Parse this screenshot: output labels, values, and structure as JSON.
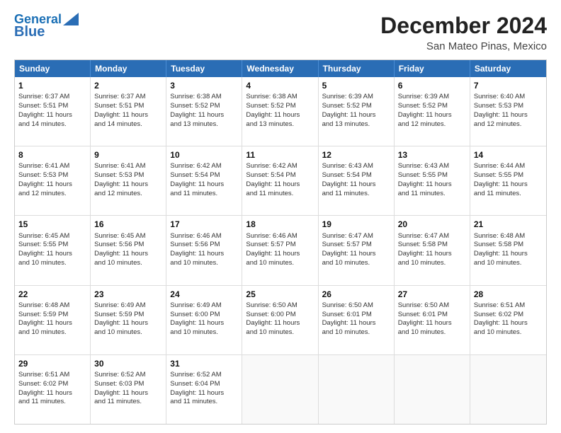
{
  "header": {
    "logo_line1": "General",
    "logo_line2": "Blue",
    "title": "December 2024",
    "location": "San Mateo Pinas, Mexico"
  },
  "weekdays": [
    "Sunday",
    "Monday",
    "Tuesday",
    "Wednesday",
    "Thursday",
    "Friday",
    "Saturday"
  ],
  "weeks": [
    [
      {
        "day": "1",
        "lines": [
          "Sunrise: 6:37 AM",
          "Sunset: 5:51 PM",
          "Daylight: 11 hours",
          "and 14 minutes."
        ]
      },
      {
        "day": "2",
        "lines": [
          "Sunrise: 6:37 AM",
          "Sunset: 5:51 PM",
          "Daylight: 11 hours",
          "and 14 minutes."
        ]
      },
      {
        "day": "3",
        "lines": [
          "Sunrise: 6:38 AM",
          "Sunset: 5:52 PM",
          "Daylight: 11 hours",
          "and 13 minutes."
        ]
      },
      {
        "day": "4",
        "lines": [
          "Sunrise: 6:38 AM",
          "Sunset: 5:52 PM",
          "Daylight: 11 hours",
          "and 13 minutes."
        ]
      },
      {
        "day": "5",
        "lines": [
          "Sunrise: 6:39 AM",
          "Sunset: 5:52 PM",
          "Daylight: 11 hours",
          "and 13 minutes."
        ]
      },
      {
        "day": "6",
        "lines": [
          "Sunrise: 6:39 AM",
          "Sunset: 5:52 PM",
          "Daylight: 11 hours",
          "and 12 minutes."
        ]
      },
      {
        "day": "7",
        "lines": [
          "Sunrise: 6:40 AM",
          "Sunset: 5:53 PM",
          "Daylight: 11 hours",
          "and 12 minutes."
        ]
      }
    ],
    [
      {
        "day": "8",
        "lines": [
          "Sunrise: 6:41 AM",
          "Sunset: 5:53 PM",
          "Daylight: 11 hours",
          "and 12 minutes."
        ]
      },
      {
        "day": "9",
        "lines": [
          "Sunrise: 6:41 AM",
          "Sunset: 5:53 PM",
          "Daylight: 11 hours",
          "and 12 minutes."
        ]
      },
      {
        "day": "10",
        "lines": [
          "Sunrise: 6:42 AM",
          "Sunset: 5:54 PM",
          "Daylight: 11 hours",
          "and 11 minutes."
        ]
      },
      {
        "day": "11",
        "lines": [
          "Sunrise: 6:42 AM",
          "Sunset: 5:54 PM",
          "Daylight: 11 hours",
          "and 11 minutes."
        ]
      },
      {
        "day": "12",
        "lines": [
          "Sunrise: 6:43 AM",
          "Sunset: 5:54 PM",
          "Daylight: 11 hours",
          "and 11 minutes."
        ]
      },
      {
        "day": "13",
        "lines": [
          "Sunrise: 6:43 AM",
          "Sunset: 5:55 PM",
          "Daylight: 11 hours",
          "and 11 minutes."
        ]
      },
      {
        "day": "14",
        "lines": [
          "Sunrise: 6:44 AM",
          "Sunset: 5:55 PM",
          "Daylight: 11 hours",
          "and 11 minutes."
        ]
      }
    ],
    [
      {
        "day": "15",
        "lines": [
          "Sunrise: 6:45 AM",
          "Sunset: 5:55 PM",
          "Daylight: 11 hours",
          "and 10 minutes."
        ]
      },
      {
        "day": "16",
        "lines": [
          "Sunrise: 6:45 AM",
          "Sunset: 5:56 PM",
          "Daylight: 11 hours",
          "and 10 minutes."
        ]
      },
      {
        "day": "17",
        "lines": [
          "Sunrise: 6:46 AM",
          "Sunset: 5:56 PM",
          "Daylight: 11 hours",
          "and 10 minutes."
        ]
      },
      {
        "day": "18",
        "lines": [
          "Sunrise: 6:46 AM",
          "Sunset: 5:57 PM",
          "Daylight: 11 hours",
          "and 10 minutes."
        ]
      },
      {
        "day": "19",
        "lines": [
          "Sunrise: 6:47 AM",
          "Sunset: 5:57 PM",
          "Daylight: 11 hours",
          "and 10 minutes."
        ]
      },
      {
        "day": "20",
        "lines": [
          "Sunrise: 6:47 AM",
          "Sunset: 5:58 PM",
          "Daylight: 11 hours",
          "and 10 minutes."
        ]
      },
      {
        "day": "21",
        "lines": [
          "Sunrise: 6:48 AM",
          "Sunset: 5:58 PM",
          "Daylight: 11 hours",
          "and 10 minutes."
        ]
      }
    ],
    [
      {
        "day": "22",
        "lines": [
          "Sunrise: 6:48 AM",
          "Sunset: 5:59 PM",
          "Daylight: 11 hours",
          "and 10 minutes."
        ]
      },
      {
        "day": "23",
        "lines": [
          "Sunrise: 6:49 AM",
          "Sunset: 5:59 PM",
          "Daylight: 11 hours",
          "and 10 minutes."
        ]
      },
      {
        "day": "24",
        "lines": [
          "Sunrise: 6:49 AM",
          "Sunset: 6:00 PM",
          "Daylight: 11 hours",
          "and 10 minutes."
        ]
      },
      {
        "day": "25",
        "lines": [
          "Sunrise: 6:50 AM",
          "Sunset: 6:00 PM",
          "Daylight: 11 hours",
          "and 10 minutes."
        ]
      },
      {
        "day": "26",
        "lines": [
          "Sunrise: 6:50 AM",
          "Sunset: 6:01 PM",
          "Daylight: 11 hours",
          "and 10 minutes."
        ]
      },
      {
        "day": "27",
        "lines": [
          "Sunrise: 6:50 AM",
          "Sunset: 6:01 PM",
          "Daylight: 11 hours",
          "and 10 minutes."
        ]
      },
      {
        "day": "28",
        "lines": [
          "Sunrise: 6:51 AM",
          "Sunset: 6:02 PM",
          "Daylight: 11 hours",
          "and 10 minutes."
        ]
      }
    ],
    [
      {
        "day": "29",
        "lines": [
          "Sunrise: 6:51 AM",
          "Sunset: 6:02 PM",
          "Daylight: 11 hours",
          "and 11 minutes."
        ]
      },
      {
        "day": "30",
        "lines": [
          "Sunrise: 6:52 AM",
          "Sunset: 6:03 PM",
          "Daylight: 11 hours",
          "and 11 minutes."
        ]
      },
      {
        "day": "31",
        "lines": [
          "Sunrise: 6:52 AM",
          "Sunset: 6:04 PM",
          "Daylight: 11 hours",
          "and 11 minutes."
        ]
      },
      null,
      null,
      null,
      null
    ]
  ]
}
